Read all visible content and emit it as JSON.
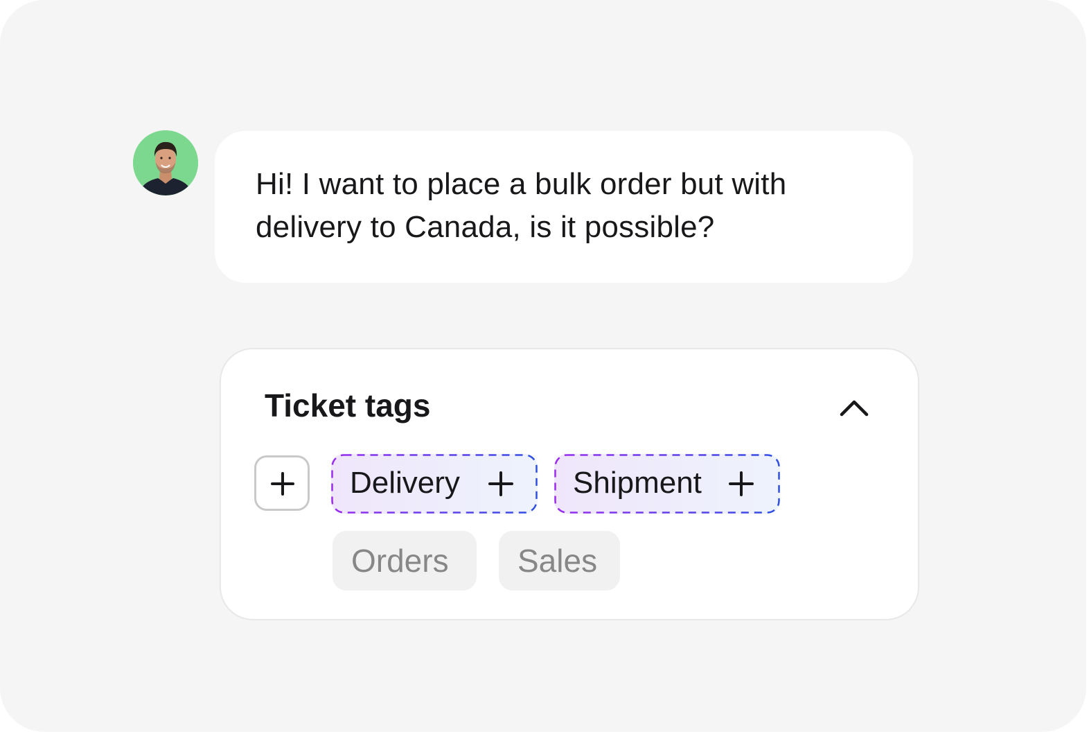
{
  "message": {
    "text": "Hi! I want to place a bulk order but with delivery to Canada, is it possible?"
  },
  "avatar": {
    "icon": "user-avatar-icon",
    "background": "#7dd88f"
  },
  "ticket_tags": {
    "title": "Ticket tags",
    "collapse_icon": "chevron-up-icon",
    "add_icon": "plus-icon",
    "suggested": [
      {
        "label": "Delivery",
        "icon": "plus-icon"
      },
      {
        "label": "Shipment",
        "icon": "plus-icon"
      }
    ],
    "existing": [
      {
        "label": "Orders"
      },
      {
        "label": "Sales"
      }
    ],
    "colors": {
      "dash_start": "#9b2cf0",
      "dash_end": "#2f4fe3",
      "existing_bg": "#f1f1f1",
      "existing_text": "#878787"
    }
  }
}
